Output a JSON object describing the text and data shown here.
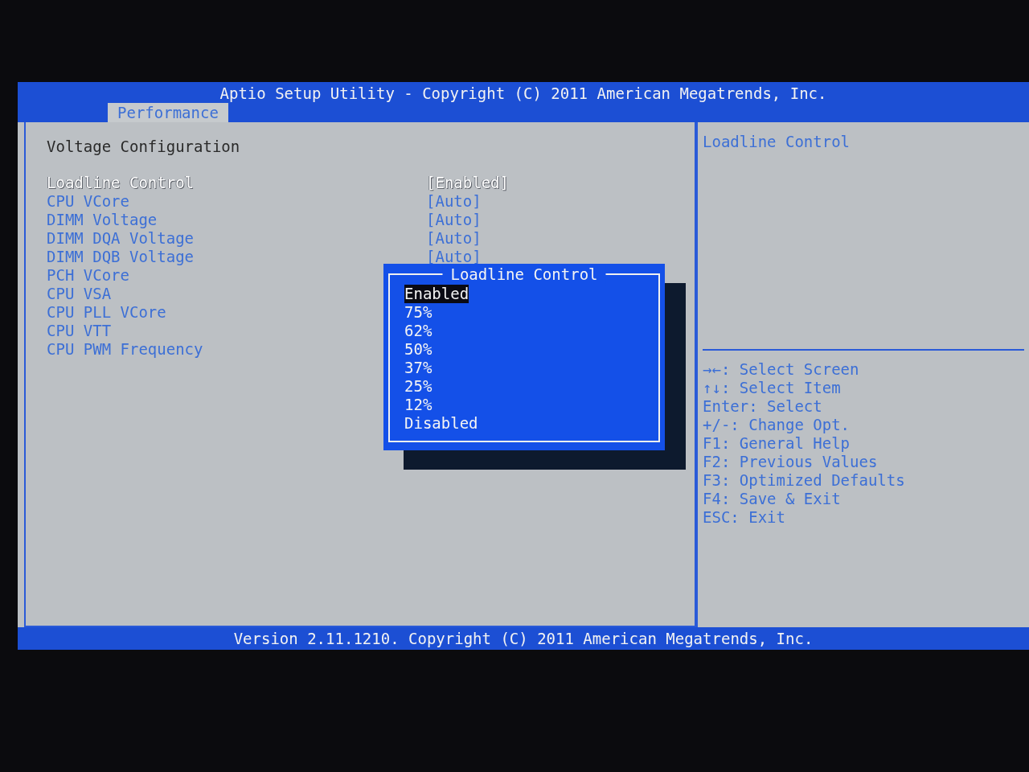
{
  "header": {
    "title": "Aptio Setup Utility - Copyright (C) 2011 American Megatrends, Inc.",
    "tabs": [
      {
        "label": "Performance",
        "selected": true
      }
    ]
  },
  "section_title": "Voltage Configuration",
  "settings": [
    {
      "label": "Loadline Control",
      "value": "[Enabled]",
      "selected": true
    },
    {
      "label": "CPU VCore",
      "value": "[Auto]",
      "selected": false
    },
    {
      "label": "DIMM Voltage",
      "value": "[Auto]",
      "selected": false
    },
    {
      "label": "DIMM DQA Voltage",
      "value": "[Auto]",
      "selected": false
    },
    {
      "label": "DIMM DQB Voltage",
      "value": "[Auto]",
      "selected": false
    },
    {
      "label": "PCH VCore",
      "selected": false
    },
    {
      "label": "CPU VSA",
      "selected": false
    },
    {
      "label": "CPU PLL VCore",
      "selected": false
    },
    {
      "label": "CPU VTT",
      "selected": false
    },
    {
      "label": "CPU PWM Frequency",
      "selected": false
    }
  ],
  "help": {
    "title": "Loadline Control",
    "keys": [
      "→←: Select Screen",
      "↑↓: Select Item",
      "Enter: Select",
      "+/-: Change Opt.",
      "F1: General Help",
      "F2: Previous Values",
      "F3: Optimized Defaults",
      "F4: Save & Exit",
      "ESC: Exit"
    ]
  },
  "popup": {
    "title": "Loadline Control",
    "options": [
      {
        "label": "Enabled",
        "selected": true
      },
      {
        "label": "75%",
        "selected": false
      },
      {
        "label": "62%",
        "selected": false
      },
      {
        "label": "50%",
        "selected": false
      },
      {
        "label": "37%",
        "selected": false
      },
      {
        "label": "25%",
        "selected": false
      },
      {
        "label": "12%",
        "selected": false
      },
      {
        "label": "Disabled",
        "selected": false
      }
    ]
  },
  "footer": "Version 2.11.1210. Copyright (C) 2011 American Megatrends, Inc."
}
